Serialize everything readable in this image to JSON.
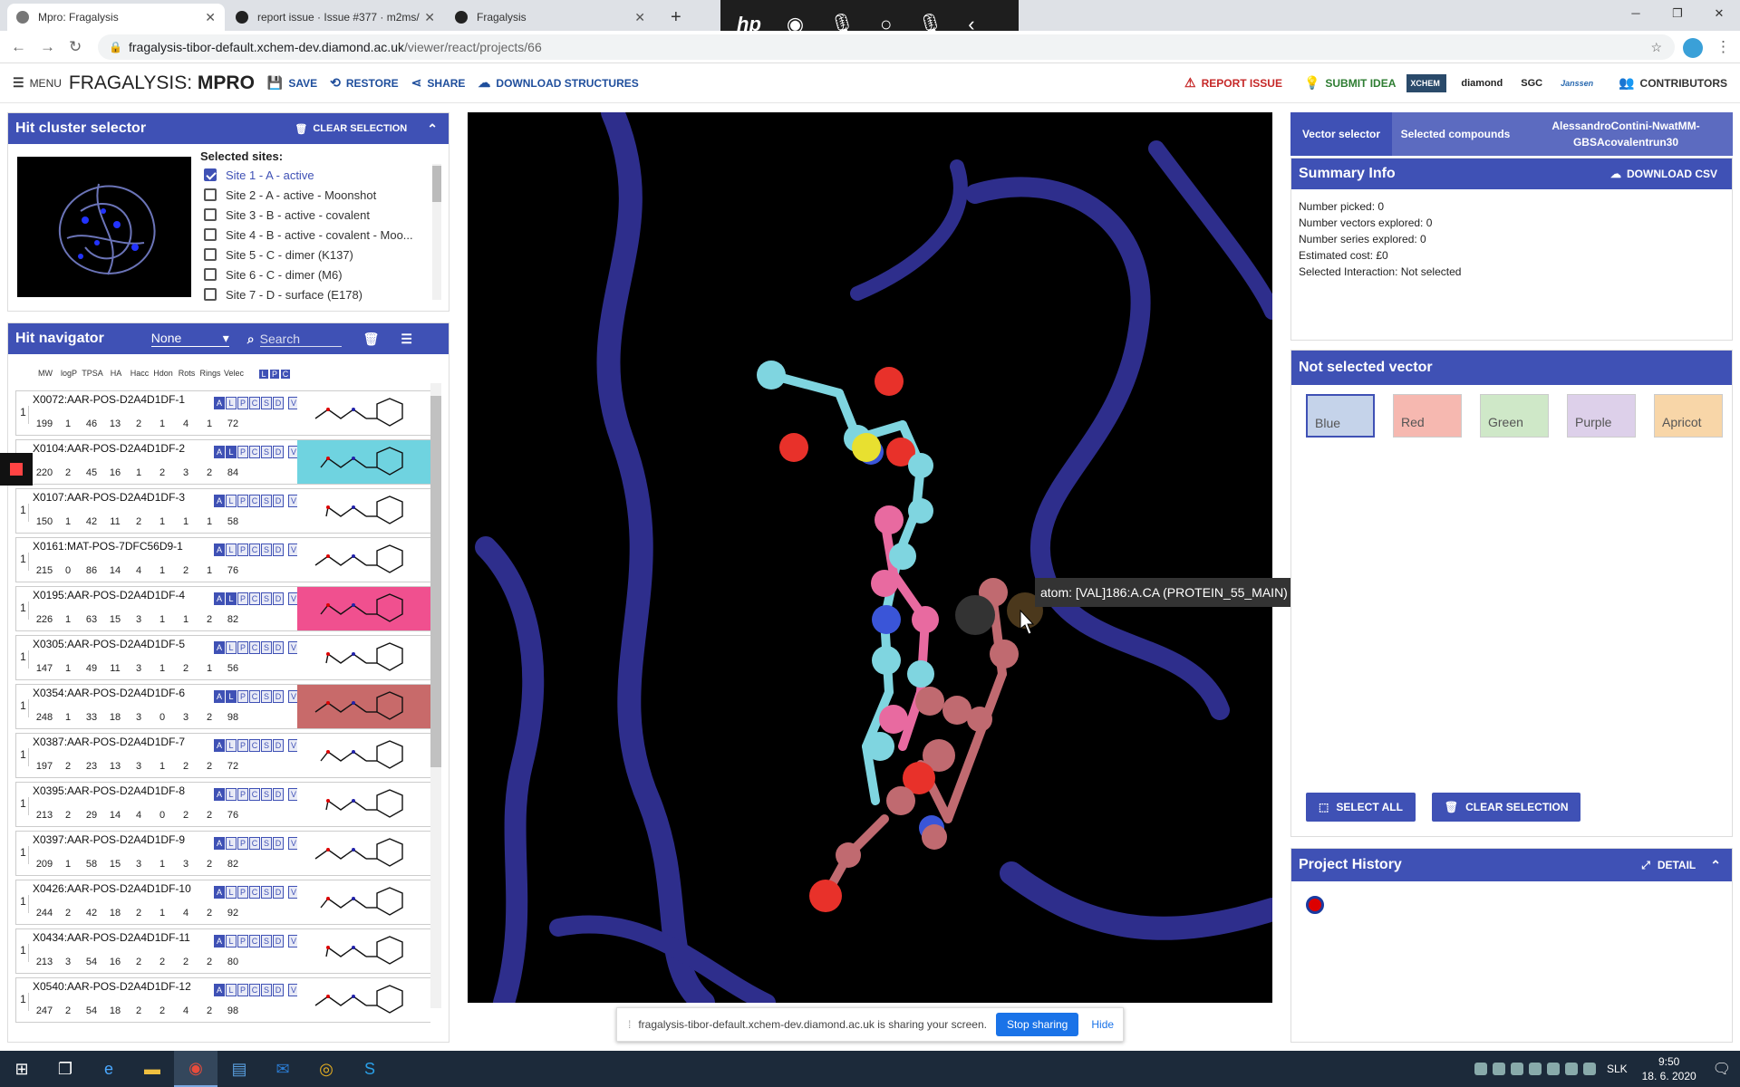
{
  "browser": {
    "tabs": [
      {
        "title": "Mpro: Fragalysis",
        "active": true
      },
      {
        "title": "report issue · Issue #377 · m2ms/",
        "active": false
      },
      {
        "title": "Fragalysis",
        "active": false
      }
    ],
    "url_host": "fragalysis-tibor-default.xchem-dev.diamond.ac.uk",
    "url_path": "/viewer/react/projects/66"
  },
  "header": {
    "menu_label": "MENU",
    "title_prefix": "FRAGALYSIS:",
    "title_target": "MPRO",
    "save_label": "SAVE",
    "restore_label": "RESTORE",
    "share_label": "SHARE",
    "download_label": "DOWNLOAD STRUCTURES",
    "report_label": "REPORT ISSUE",
    "submit_label": "SUBMIT IDEA",
    "logos": [
      "XCHEM",
      "diamond",
      "SGC",
      "Janssen"
    ],
    "contributors_label": "CONTRIBUTORS"
  },
  "hit_cluster": {
    "title": "Hit cluster selector",
    "clear_label": "CLEAR SELECTION",
    "sites_label": "Selected sites:",
    "sites": [
      {
        "label": "Site 1 - A - active",
        "checked": true
      },
      {
        "label": "Site 2 - A - active - Moonshot",
        "checked": false
      },
      {
        "label": "Site 3 - B - active - covalent",
        "checked": false
      },
      {
        "label": "Site 4 - B - active - covalent - Moo...",
        "checked": false
      },
      {
        "label": "Site 5 - C - dimer (K137)",
        "checked": false
      },
      {
        "label": "Site 6 - C - dimer (M6)",
        "checked": false
      },
      {
        "label": "Site 7 - D - surface (E178)",
        "checked": false
      }
    ]
  },
  "hit_navigator": {
    "title": "Hit navigator",
    "select_value": "None",
    "search_placeholder": "Search",
    "columns": [
      "MW",
      "logP",
      "TPSA",
      "HA",
      "Hacc",
      "Hdon",
      "Rots",
      "Rings",
      "Velec"
    ],
    "lpc": [
      "L",
      "P",
      "C"
    ],
    "rows": [
      {
        "num": "1",
        "name": "X0072:AAR-POS-D2A4D1DF-1",
        "values": [
          "199",
          "1",
          "46",
          "13",
          "2",
          "1",
          "4",
          "1",
          "72"
        ],
        "highlight": "#ffffff",
        "l_on": false
      },
      {
        "num": "1",
        "name": "X0104:AAR-POS-D2A4D1DF-2",
        "values": [
          "220",
          "2",
          "45",
          "16",
          "1",
          "2",
          "3",
          "2",
          "84"
        ],
        "highlight": "#6fd3e0",
        "l_on": true
      },
      {
        "num": "1",
        "name": "X0107:AAR-POS-D2A4D1DF-3",
        "values": [
          "150",
          "1",
          "42",
          "11",
          "2",
          "1",
          "1",
          "1",
          "58"
        ],
        "highlight": "#ffffff",
        "l_on": false
      },
      {
        "num": "1",
        "name": "X0161:MAT-POS-7DFC56D9-1",
        "values": [
          "215",
          "0",
          "86",
          "14",
          "4",
          "1",
          "2",
          "1",
          "76"
        ],
        "highlight": "#ffffff",
        "l_on": false
      },
      {
        "num": "1",
        "name": "X0195:AAR-POS-D2A4D1DF-4",
        "values": [
          "226",
          "1",
          "63",
          "15",
          "3",
          "1",
          "1",
          "2",
          "82"
        ],
        "highlight": "#f0508f",
        "l_on": true
      },
      {
        "num": "1",
        "name": "X0305:AAR-POS-D2A4D1DF-5",
        "values": [
          "147",
          "1",
          "49",
          "11",
          "3",
          "1",
          "2",
          "1",
          "56"
        ],
        "highlight": "#ffffff",
        "l_on": false
      },
      {
        "num": "1",
        "name": "X0354:AAR-POS-D2A4D1DF-6",
        "values": [
          "248",
          "1",
          "33",
          "18",
          "3",
          "0",
          "3",
          "2",
          "98"
        ],
        "highlight": "#c86a6a",
        "l_on": true
      },
      {
        "num": "1",
        "name": "X0387:AAR-POS-D2A4D1DF-7",
        "values": [
          "197",
          "2",
          "23",
          "13",
          "3",
          "1",
          "2",
          "2",
          "72"
        ],
        "highlight": "#ffffff",
        "l_on": false
      },
      {
        "num": "1",
        "name": "X0395:AAR-POS-D2A4D1DF-8",
        "values": [
          "213",
          "2",
          "29",
          "14",
          "4",
          "0",
          "2",
          "2",
          "76"
        ],
        "highlight": "#ffffff",
        "l_on": false
      },
      {
        "num": "1",
        "name": "X0397:AAR-POS-D2A4D1DF-9",
        "values": [
          "209",
          "1",
          "58",
          "15",
          "3",
          "1",
          "3",
          "2",
          "82"
        ],
        "highlight": "#ffffff",
        "l_on": false
      },
      {
        "num": "1",
        "name": "X0426:AAR-POS-D2A4D1DF-10",
        "values": [
          "244",
          "2",
          "42",
          "18",
          "2",
          "1",
          "4",
          "2",
          "92"
        ],
        "highlight": "#ffffff",
        "l_on": false
      },
      {
        "num": "1",
        "name": "X0434:AAR-POS-D2A4D1DF-11",
        "values": [
          "213",
          "3",
          "54",
          "16",
          "2",
          "2",
          "2",
          "2",
          "80"
        ],
        "highlight": "#ffffff",
        "l_on": false
      },
      {
        "num": "1",
        "name": "X0540:AAR-POS-D2A4D1DF-12",
        "values": [
          "247",
          "2",
          "54",
          "18",
          "2",
          "2",
          "4",
          "2",
          "98"
        ],
        "highlight": "#ffffff",
        "l_on": false
      }
    ]
  },
  "viewer": {
    "tooltip": "atom: [VAL]186:A.CA (PROTEIN_55_MAIN)"
  },
  "share_bar": {
    "message": "fragalysis-tibor-default.xchem-dev.diamond.ac.uk is sharing your screen.",
    "stop_label": "Stop sharing",
    "hide_label": "Hide"
  },
  "right": {
    "tabs": [
      "Vector selector",
      "Selected compounds",
      "AlessandroContini-NwatMM-GBSAcovalentrun30"
    ],
    "summary": {
      "title": "Summary Info",
      "download_label": "DOWNLOAD CSV",
      "lines": [
        "Number picked: 0",
        "Number vectors explored: 0",
        "Number series explored: 0",
        "Estimated cost: £0",
        "Selected Interaction: Not selected"
      ]
    },
    "vector": {
      "title": "Not selected vector",
      "swatches": [
        {
          "label": "Blue",
          "color": "#c5d3ea",
          "selected": true
        },
        {
          "label": "Red",
          "color": "#f6b8b0",
          "selected": false
        },
        {
          "label": "Green",
          "color": "#cfe8c8",
          "selected": false
        },
        {
          "label": "Purple",
          "color": "#ddd0ea",
          "selected": false
        },
        {
          "label": "Apricot",
          "color": "#f8d6a8",
          "selected": false
        }
      ],
      "select_all_label": "SELECT ALL",
      "clear_label": "CLEAR SELECTION"
    },
    "history": {
      "title": "Project History",
      "detail_label": "DETAIL"
    }
  },
  "taskbar": {
    "lang": "SLK",
    "time": "9:50",
    "date": "18. 6. 2020"
  },
  "colors": {
    "primary": "#3f51b5",
    "tab_inactive": "#5c6bc0"
  }
}
